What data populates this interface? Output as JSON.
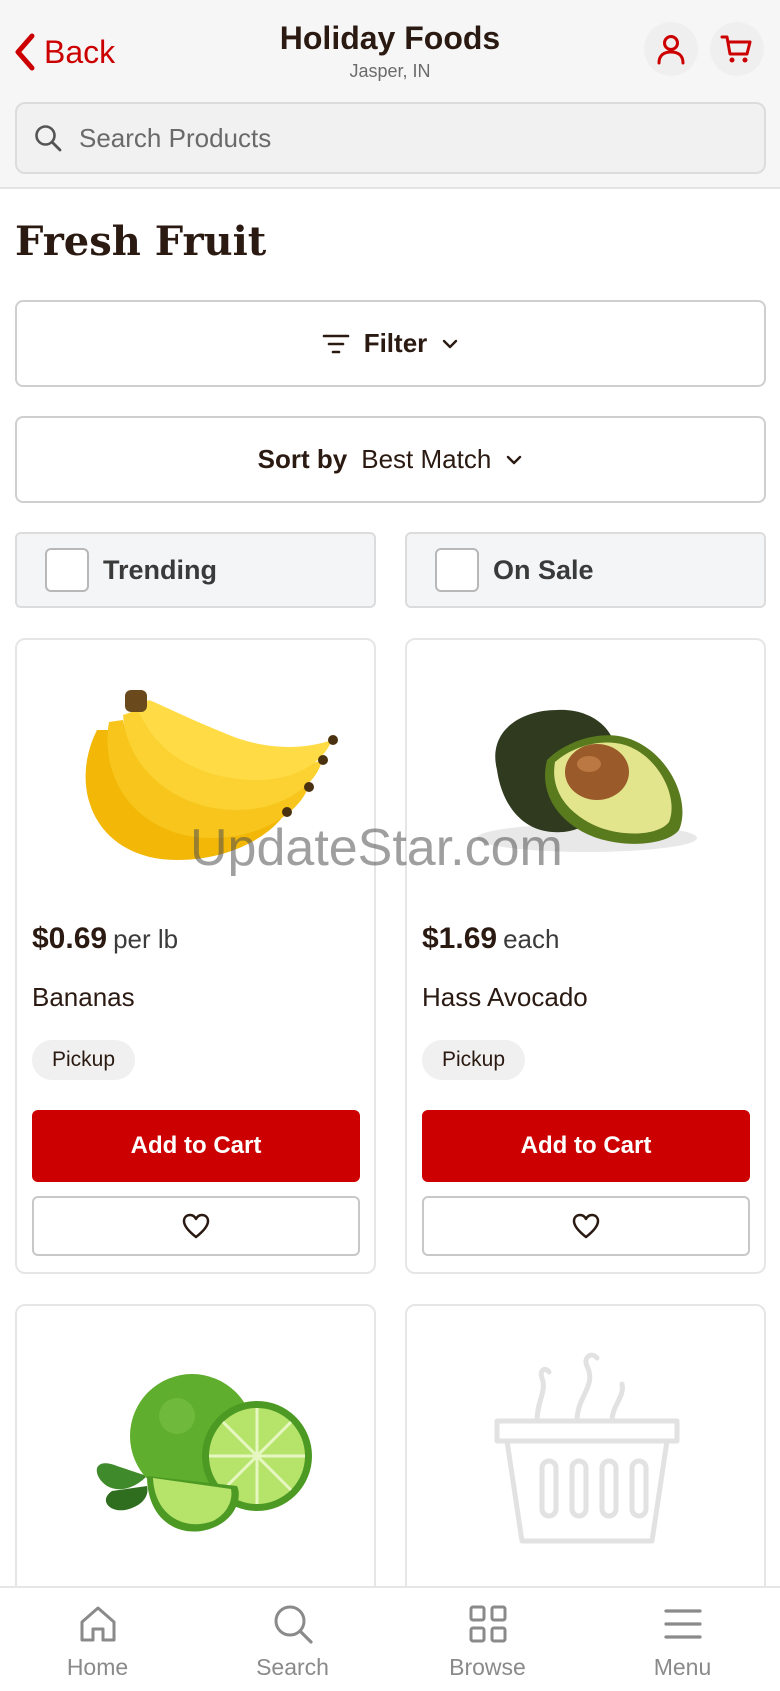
{
  "header": {
    "back_label": "Back",
    "store_name": "Holiday Foods",
    "store_location": "Jasper, IN",
    "account_icon": "person-icon",
    "cart_icon": "cart-icon"
  },
  "search": {
    "placeholder": "Search Products"
  },
  "page": {
    "title": "Fresh Fruit"
  },
  "filter": {
    "label": "Filter"
  },
  "sort": {
    "label": "Sort by",
    "value": "Best Match"
  },
  "toggles": {
    "trending": {
      "label": "Trending",
      "checked": false
    },
    "on_sale": {
      "label": "On Sale",
      "checked": false
    }
  },
  "products": [
    {
      "price": "$0.69",
      "unit": "per lb",
      "name": "Bananas",
      "badge": "Pickup",
      "add_label": "Add to Cart",
      "image": "bananas"
    },
    {
      "price": "$1.69",
      "unit": "each",
      "name": "Hass Avocado",
      "badge": "Pickup",
      "add_label": "Add to Cart",
      "image": "avocado"
    },
    {
      "image": "limes"
    },
    {
      "image": "placeholder-basket"
    }
  ],
  "watermark": "UpdateStar.com",
  "bottom_nav": [
    {
      "label": "Home",
      "icon": "home-icon"
    },
    {
      "label": "Search",
      "icon": "search-icon"
    },
    {
      "label": "Browse",
      "icon": "grid-icon"
    },
    {
      "label": "Menu",
      "icon": "menu-icon"
    }
  ],
  "colors": {
    "accent": "#cc0000",
    "text": "#2b1a12"
  }
}
